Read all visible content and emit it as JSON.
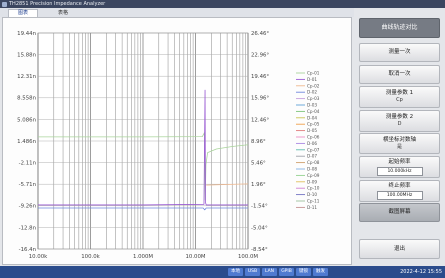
{
  "window": {
    "title": "TH2851 Precision Impedance Analyzer"
  },
  "tabs": [
    {
      "label": "图表",
      "active": true
    },
    {
      "label": "表格",
      "active": false
    }
  ],
  "chart_data": {
    "type": "line",
    "x_scale": "log",
    "xlim": [
      10000,
      100000000
    ],
    "x_ticks": [
      "10.00k",
      "100.0k",
      "1.000M",
      "10.00M",
      "100.0M"
    ],
    "y_left": {
      "ticks": [
        "19.44n",
        "15.88n",
        "12.31n",
        "8.558n",
        "5.086n",
        "1.486n",
        "-2.11n",
        "-5.71n",
        "-9.26n",
        "-12.8n",
        "-16.4n"
      ],
      "lim": [
        -16.4,
        19.44
      ]
    },
    "y_right": {
      "ticks": [
        "26.46°",
        "22.96°",
        "19.46°",
        "15.96°",
        "12.46°",
        "8.96°",
        "5.46°",
        "1.96°",
        "-1.54°",
        "-5.04°",
        "-8.54°"
      ],
      "lim": [
        -8.54,
        26.46
      ]
    },
    "grid": true,
    "legend_position": "right",
    "series": [
      {
        "name": "Cp-01",
        "color": "#a9d49b",
        "axis": "left",
        "points": [
          [
            10000,
            2.2
          ],
          [
            1000000,
            2.2
          ],
          [
            13500000,
            2.25
          ],
          [
            14800000,
            2.9
          ],
          [
            15300000,
            -8.3
          ],
          [
            15800000,
            -2.4
          ],
          [
            17000000,
            -0.4
          ],
          [
            25000000,
            0.2
          ],
          [
            50000000,
            0.6
          ],
          [
            100000000,
            0.9
          ]
        ]
      },
      {
        "name": "D-01",
        "color": "#9a5bd3",
        "axis": "right",
        "points": [
          [
            10000,
            -1.4
          ],
          [
            1000000,
            -1.4
          ],
          [
            14500000,
            -1.3
          ],
          [
            15200000,
            17.2
          ],
          [
            15500000,
            -1.0
          ],
          [
            16000000,
            -1.4
          ],
          [
            100000000,
            -1.4
          ]
        ]
      },
      {
        "name": "Cp-02",
        "color": "#efb88e",
        "axis": "left",
        "points": [
          [
            16000000,
            -5.8
          ],
          [
            40000000,
            -5.7
          ],
          [
            100000000,
            -5.6
          ]
        ]
      },
      {
        "name": "D-02",
        "color": "#6f86dc",
        "axis": "right",
        "points": [
          [
            10000,
            -1.9
          ],
          [
            14000000,
            -1.9
          ],
          [
            15000000,
            -2.2
          ],
          [
            16000000,
            -1.9
          ],
          [
            100000000,
            -1.9
          ]
        ]
      },
      {
        "name": "Cp-03",
        "color": "#c59fdd"
      },
      {
        "name": "D-03",
        "color": "#5ea3d6"
      },
      {
        "name": "Cp-04",
        "color": "#7cc47a"
      },
      {
        "name": "D-04",
        "color": "#c9c452"
      },
      {
        "name": "Cp-05",
        "color": "#f0a04b"
      },
      {
        "name": "D-05",
        "color": "#e07a7a"
      },
      {
        "name": "Cp-06",
        "color": "#ef8fc4"
      },
      {
        "name": "D-06",
        "color": "#a987e3"
      },
      {
        "name": "Cp-07",
        "color": "#5fbdaf"
      },
      {
        "name": "D-07",
        "color": "#9ea3aa"
      },
      {
        "name": "Cp-08",
        "color": "#cfa06c"
      },
      {
        "name": "D-08",
        "color": "#84b2e4"
      },
      {
        "name": "Cp-09",
        "color": "#93d18e"
      },
      {
        "name": "D-09",
        "color": "#dfc05c"
      },
      {
        "name": "Cp-10",
        "color": "#d282d2"
      },
      {
        "name": "D-10",
        "color": "#7373c3"
      },
      {
        "name": "Cp-11",
        "color": "#9fc09f"
      },
      {
        "name": "D-11",
        "color": "#c49191"
      }
    ]
  },
  "panel": {
    "header": "曲线轨迹对比",
    "measure_once": "测量一次",
    "cancel_once": "取消一次",
    "param1": {
      "label": "测量参数 1",
      "value": "Cp"
    },
    "param2": {
      "label": "测量参数 2",
      "value": "D"
    },
    "x_log": {
      "label": "横坐标对数轴",
      "value": "是"
    },
    "start_freq": {
      "label": "起始频率",
      "value": "10.000kHz"
    },
    "stop_freq": {
      "label": "终止频率",
      "value": "100.00MHz"
    },
    "screenshot": "截图屏幕",
    "exit": "退出"
  },
  "status_bar": {
    "items": [
      "本地",
      "USB",
      "LAN",
      "GPIB",
      "键锁",
      "触发"
    ],
    "datetime": "2022-4-12 15:55"
  },
  "colors": {
    "title_bar": "#3b4660",
    "status_bar": "#2b4c8c",
    "panel_header": "#767b84",
    "selected_button": "#a9adb3"
  }
}
